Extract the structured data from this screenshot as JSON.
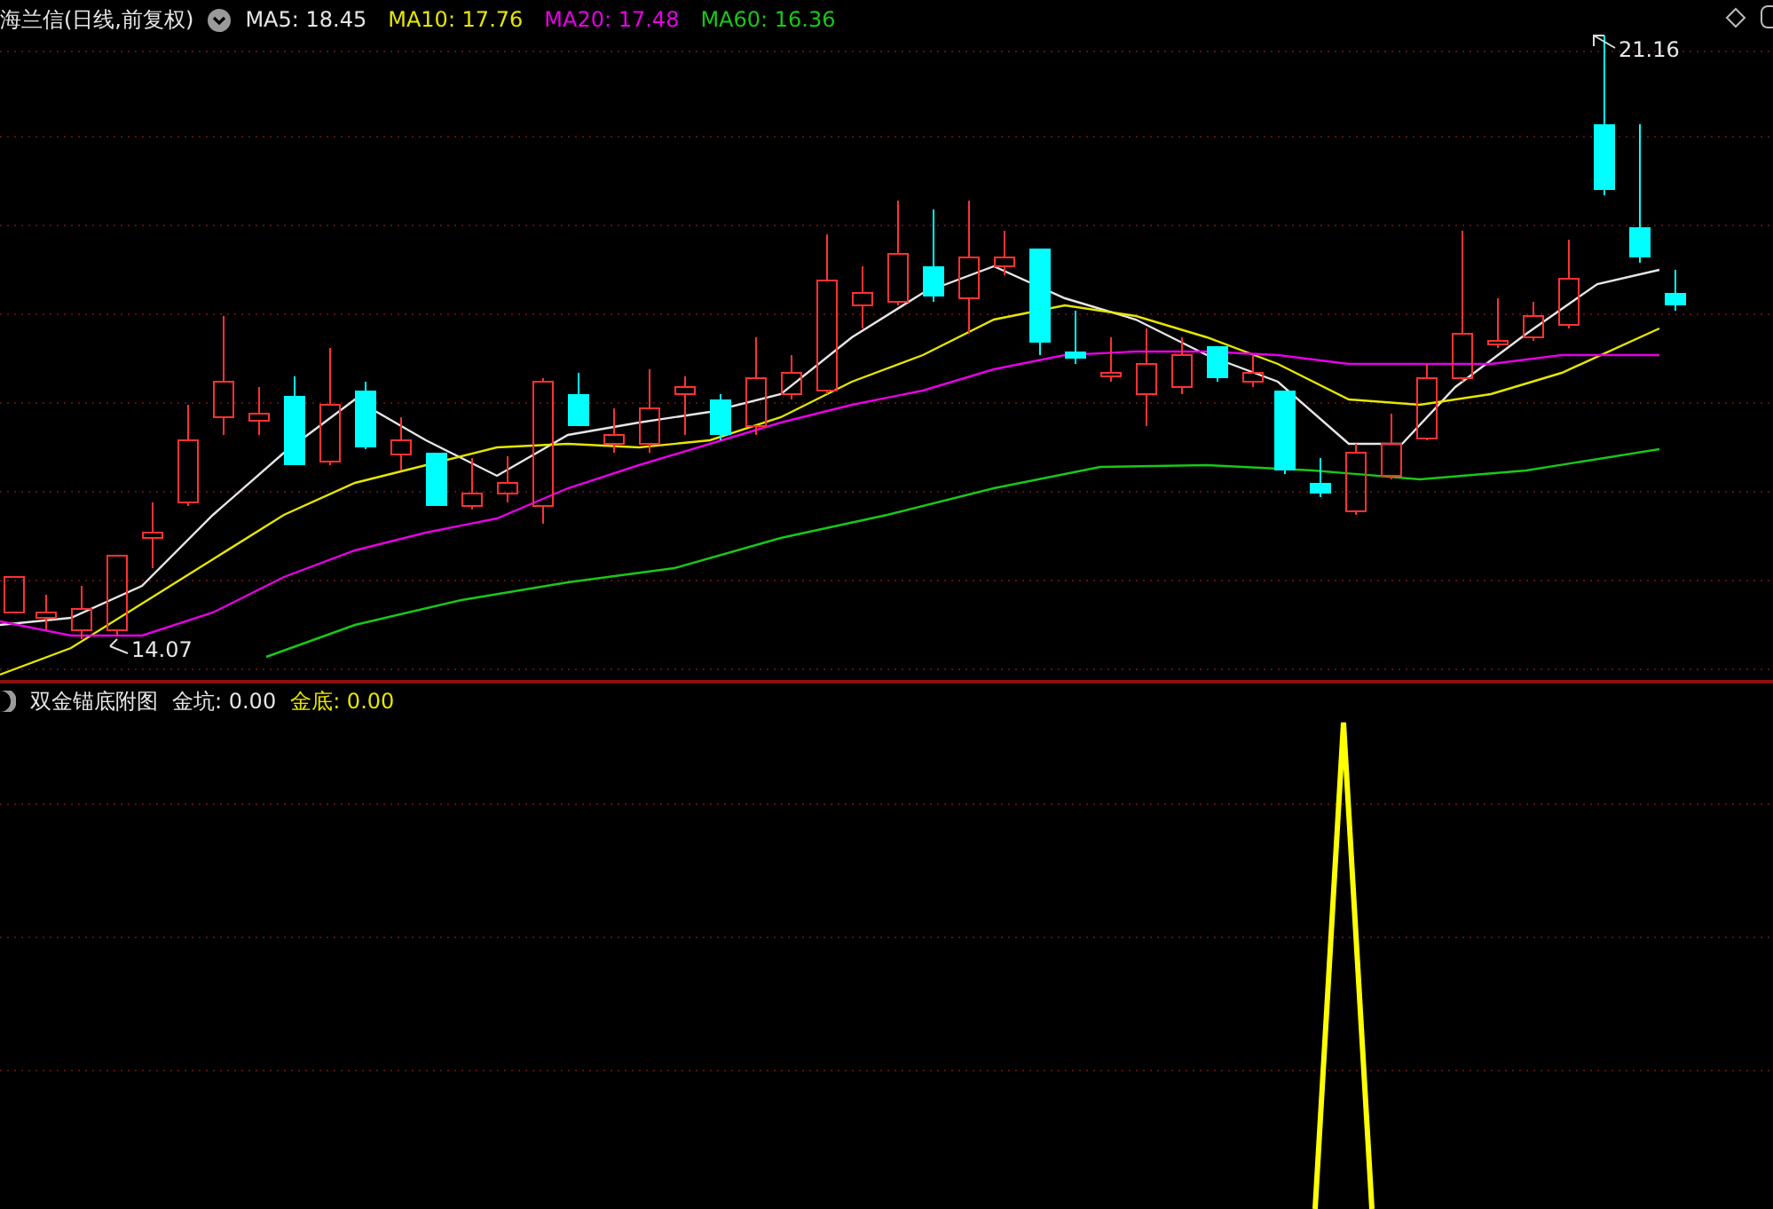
{
  "main_panel": {
    "title": "海兰信(日线,前复权)",
    "indicators": [
      {
        "label": "MA5: 18.45",
        "color": "#e6e6e6"
      },
      {
        "label": "MA10: 17.76",
        "color": "#e6e600"
      },
      {
        "label": "MA20: 17.48",
        "color": "#e600e6"
      },
      {
        "label": "MA60: 16.36",
        "color": "#19c819"
      }
    ],
    "high_label": "21.16",
    "low_label": "14.07"
  },
  "sub_panel": {
    "title": "双金锚底附图",
    "indicators": [
      {
        "label": "金坑: 0.00",
        "color": "#e6e6e6"
      },
      {
        "label": "金底: 0.00",
        "color": "#e6e600"
      }
    ]
  }
}
